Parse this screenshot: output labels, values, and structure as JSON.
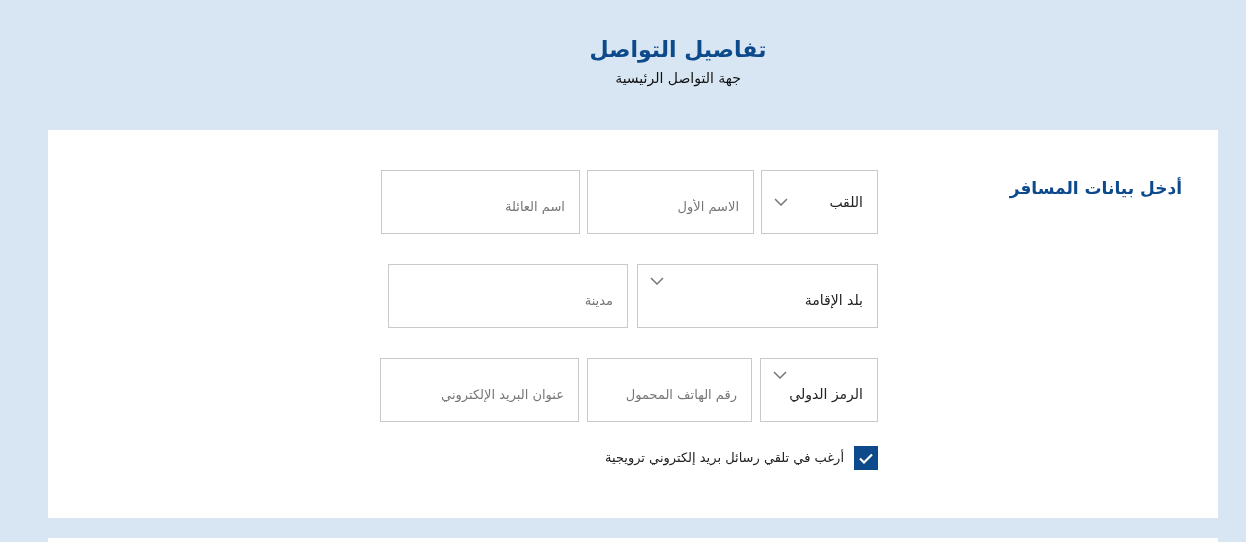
{
  "header": {
    "title": "تفاصيل التواصل",
    "subtitle": "جهة التواصل الرئيسية"
  },
  "section": {
    "title": "أدخل بيانات المسافر"
  },
  "rows": [
    [
      {
        "kind": "select",
        "label": "اللقب"
      },
      {
        "kind": "input",
        "placeholder": "الاسم الأول"
      },
      {
        "kind": "input",
        "placeholder": "اسم العائلة"
      }
    ],
    [
      {
        "kind": "select",
        "label": "بلد الإقامة"
      },
      {
        "kind": "input",
        "placeholder": "مدينة"
      }
    ],
    [
      {
        "kind": "select",
        "label": "الرمز الدولي"
      },
      {
        "kind": "input",
        "placeholder": "رقم الهاتف المحمول"
      },
      {
        "kind": "input",
        "placeholder": "عنوان البريد الإلكتروني"
      }
    ]
  ],
  "consent": {
    "checked": true,
    "label": "أرغب في تلقي رسائل بريد إلكتروني ترويجية"
  }
}
